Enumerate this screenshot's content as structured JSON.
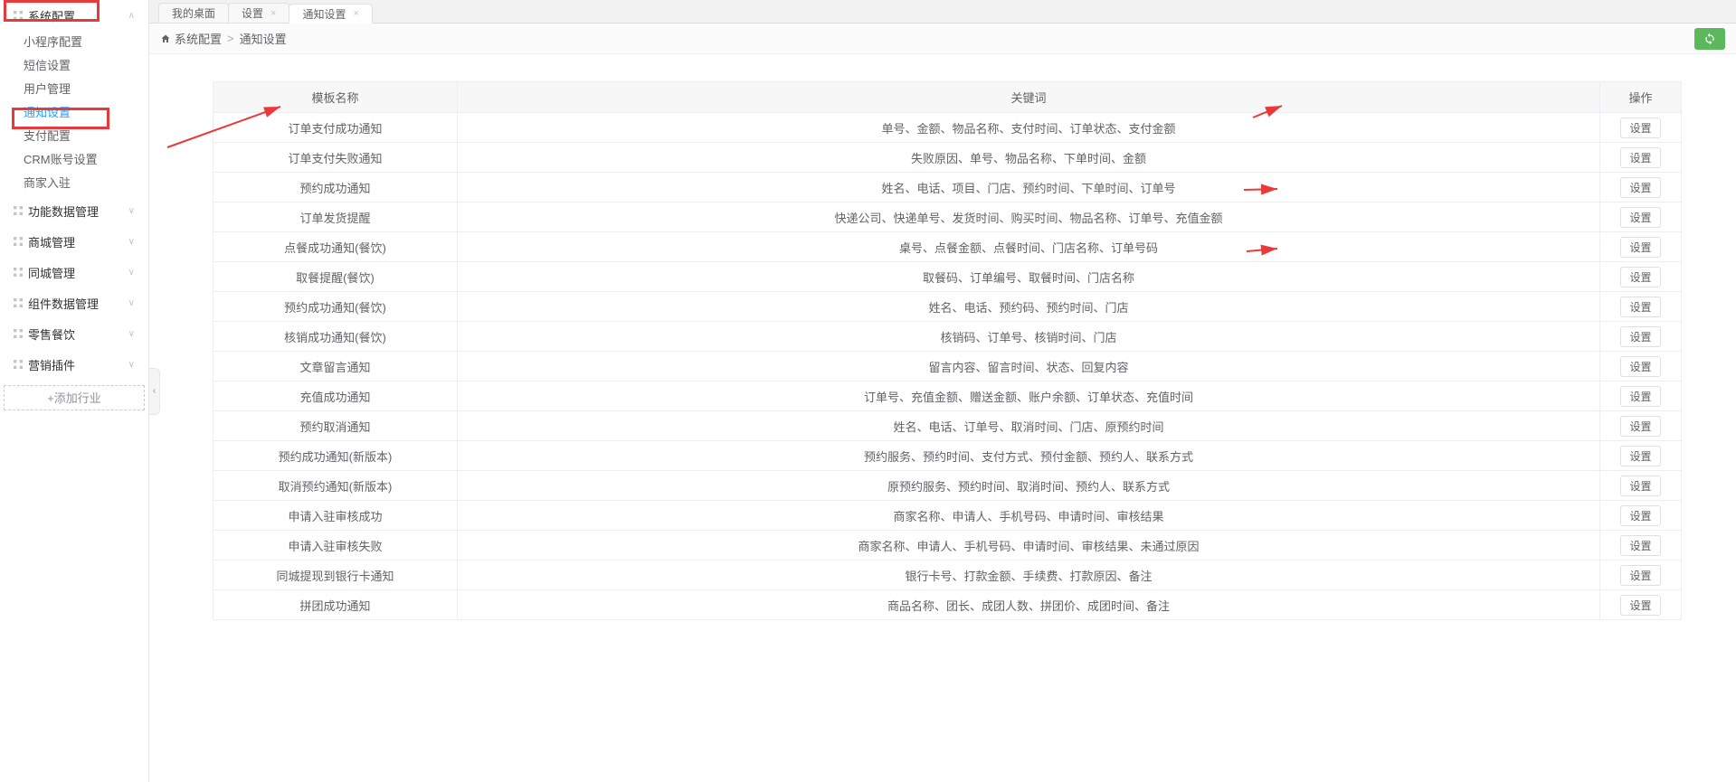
{
  "sidebar": {
    "groups": [
      {
        "label": "系统配置",
        "expanded": true,
        "items": [
          {
            "label": "小程序配置"
          },
          {
            "label": "短信设置"
          },
          {
            "label": "用户管理"
          },
          {
            "label": "通知设置",
            "active": true
          },
          {
            "label": "支付配置"
          },
          {
            "label": "CRM账号设置"
          },
          {
            "label": "商家入驻"
          }
        ]
      },
      {
        "label": "功能数据管理",
        "expanded": false
      },
      {
        "label": "商城管理",
        "expanded": false
      },
      {
        "label": "同城管理",
        "expanded": false
      },
      {
        "label": "组件数据管理",
        "expanded": false
      },
      {
        "label": "零售餐饮",
        "expanded": false
      },
      {
        "label": "营销插件",
        "expanded": false
      }
    ],
    "add_label": "+添加行业"
  },
  "tabs": [
    {
      "label": "我的桌面",
      "closable": false
    },
    {
      "label": "设置",
      "closable": true
    },
    {
      "label": "通知设置",
      "closable": true,
      "active": true
    }
  ],
  "breadcrumb": [
    "系统配置",
    "通知设置"
  ],
  "table": {
    "headers": [
      "模板名称",
      "关键词",
      "操作"
    ],
    "action_label": "设置",
    "rows": [
      {
        "name": "订单支付成功通知",
        "keywords": "单号、金额、物品名称、支付时间、订单状态、支付金额"
      },
      {
        "name": "订单支付失败通知",
        "keywords": "失败原因、单号、物品名称、下单时间、金额"
      },
      {
        "name": "预约成功通知",
        "keywords": "姓名、电话、项目、门店、预约时间、下单时间、订单号"
      },
      {
        "name": "订单发货提醒",
        "keywords": "快递公司、快递单号、发货时间、购买时间、物品名称、订单号、充值金额"
      },
      {
        "name": "点餐成功通知(餐饮)",
        "keywords": "桌号、点餐金额、点餐时间、门店名称、订单号码"
      },
      {
        "name": "取餐提醒(餐饮)",
        "keywords": "取餐码、订单编号、取餐时间、门店名称"
      },
      {
        "name": "预约成功通知(餐饮)",
        "keywords": "姓名、电话、预约码、预约时间、门店"
      },
      {
        "name": "核销成功通知(餐饮)",
        "keywords": "核销码、订单号、核销时间、门店"
      },
      {
        "name": "文章留言通知",
        "keywords": "留言内容、留言时间、状态、回复内容"
      },
      {
        "name": "充值成功通知",
        "keywords": "订单号、充值金额、赠送金额、账户余额、订单状态、充值时间"
      },
      {
        "name": "预约取消通知",
        "keywords": "姓名、电话、订单号、取消时间、门店、原预约时间"
      },
      {
        "name": "预约成功通知(新版本)",
        "keywords": "预约服务、预约时间、支付方式、预付金额、预约人、联系方式"
      },
      {
        "name": "取消预约通知(新版本)",
        "keywords": "原预约服务、预约时间、取消时间、预约人、联系方式"
      },
      {
        "name": "申请入驻审核成功",
        "keywords": "商家名称、申请人、手机号码、申请时间、审核结果"
      },
      {
        "name": "申请入驻审核失败",
        "keywords": "商家名称、申请人、手机号码、申请时间、审核结果、未通过原因"
      },
      {
        "name": "同城提现到银行卡通知",
        "keywords": "银行卡号、打款金额、手续费、打款原因、备注"
      },
      {
        "name": "拼团成功通知",
        "keywords": "商品名称、团长、成团人数、拼团价、成团时间、备注"
      }
    ]
  },
  "annotation_color": "#e83a3a"
}
